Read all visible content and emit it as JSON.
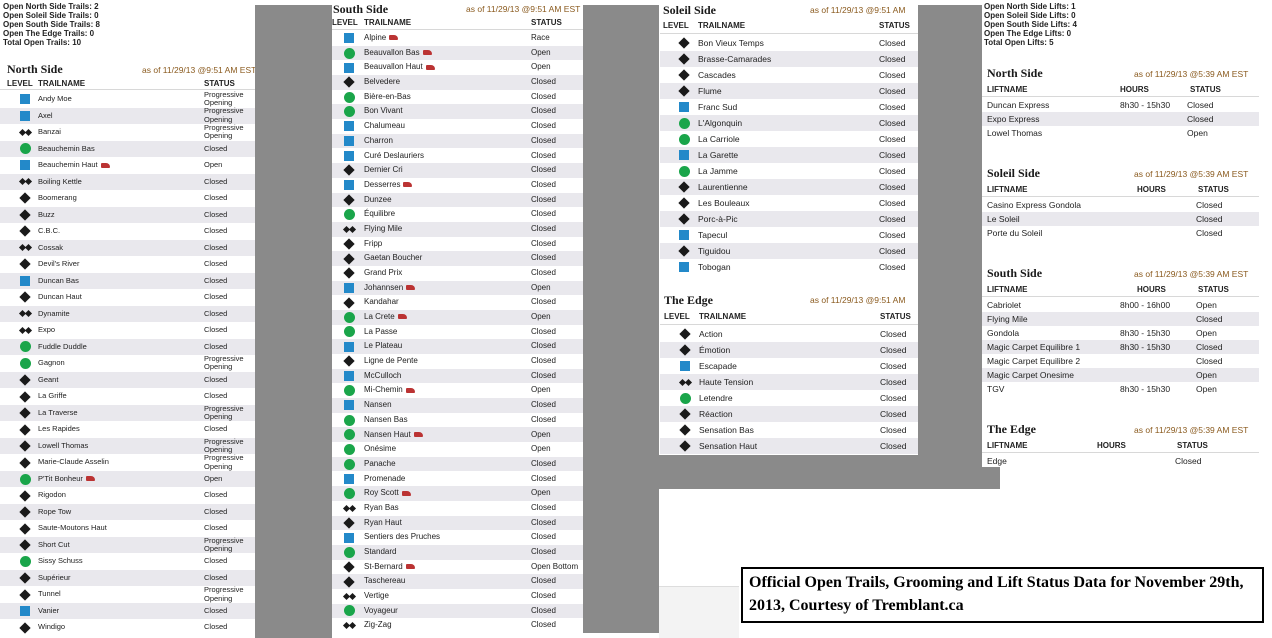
{
  "summary_trails": [
    "Open North Side Trails: 2",
    "Open Soleil Side Trails: 0",
    "Open South Side Trails: 8",
    "Open The Edge Trails: 0",
    "Total Open Trails: 10"
  ],
  "summary_lifts": [
    "Open North Side Lifts: 1",
    "Open Soleil Side Lifts: 0",
    "Open South Side Lifts: 4",
    "Open The Edge Lifts: 0",
    "Total Open Lifts: 5"
  ],
  "headers": {
    "level": "LEVEL",
    "trailname": "TRAILNAME",
    "status": "STATUS",
    "liftname": "LIFTNAME",
    "hours": "HOURS"
  },
  "legend_icons": {
    "sq": "blue-square-icon",
    "ci": "green-circle-icon",
    "dm": "black-diamond-icon",
    "dd": "double-black-diamond-icon"
  },
  "colors": {
    "blue": "#2389c9",
    "green": "#1aa54a",
    "black": "#1a1a1a",
    "asof": "#8a5a1e"
  },
  "north": {
    "title": "North Side",
    "asof": "as of 11/29/13 @9:51 AM EST",
    "trails": [
      {
        "level": "sq",
        "name": "Andy Moe",
        "status": "Progressive Opening"
      },
      {
        "level": "sq",
        "name": "Axel",
        "status": "Progressive Opening"
      },
      {
        "level": "dd",
        "name": "Banzai",
        "status": "Progressive Opening"
      },
      {
        "level": "ci",
        "name": "Beauchemin Bas",
        "status": "Closed"
      },
      {
        "level": "sq",
        "name": "Beauchemin Haut",
        "status": "Open",
        "groomed": true
      },
      {
        "level": "dd",
        "name": "Boiling Kettle",
        "status": "Closed"
      },
      {
        "level": "dm",
        "name": "Boomerang",
        "status": "Closed"
      },
      {
        "level": "dm",
        "name": "Buzz",
        "status": "Closed"
      },
      {
        "level": "dm",
        "name": "C.B.C.",
        "status": "Closed"
      },
      {
        "level": "dd",
        "name": "Cossak",
        "status": "Closed"
      },
      {
        "level": "dm",
        "name": "Devil's River",
        "status": "Closed"
      },
      {
        "level": "sq",
        "name": "Duncan Bas",
        "status": "Closed"
      },
      {
        "level": "dm",
        "name": "Duncan Haut",
        "status": "Closed"
      },
      {
        "level": "dd",
        "name": "Dynamite",
        "status": "Closed"
      },
      {
        "level": "dd",
        "name": "Expo",
        "status": "Closed"
      },
      {
        "level": "ci",
        "name": "Fuddle Duddle",
        "status": "Closed"
      },
      {
        "level": "ci",
        "name": "Gagnon",
        "status": "Progressive Opening"
      },
      {
        "level": "dm",
        "name": "Geant",
        "status": "Closed"
      },
      {
        "level": "dm",
        "name": "La Griffe",
        "status": "Closed"
      },
      {
        "level": "dm",
        "name": "La Traverse",
        "status": "Progressive Opening"
      },
      {
        "level": "dm",
        "name": "Les Rapides",
        "status": "Closed"
      },
      {
        "level": "dm",
        "name": "Lowell Thomas",
        "status": "Progressive Opening"
      },
      {
        "level": "dm",
        "name": "Marie-Claude Asselin",
        "status": "Progressive Opening"
      },
      {
        "level": "ci",
        "name": "P'Tit Bonheur",
        "status": "Open",
        "groomed": true
      },
      {
        "level": "dm",
        "name": "Rigodon",
        "status": "Closed"
      },
      {
        "level": "dm",
        "name": "Rope Tow",
        "status": "Closed"
      },
      {
        "level": "dm",
        "name": "Saute-Moutons Haut",
        "status": "Closed"
      },
      {
        "level": "dm",
        "name": "Short Cut",
        "status": "Progressive Opening"
      },
      {
        "level": "ci",
        "name": "Sissy Schuss",
        "status": "Closed"
      },
      {
        "level": "dm",
        "name": "Supérieur",
        "status": "Closed"
      },
      {
        "level": "dm",
        "name": "Tunnel",
        "status": "Progressive Opening"
      },
      {
        "level": "sq",
        "name": "Vanier",
        "status": "Closed"
      },
      {
        "level": "dm",
        "name": "Windigo",
        "status": "Closed"
      }
    ]
  },
  "south": {
    "title": "South Side",
    "asof": "as of 11/29/13 @9:51 AM EST",
    "trails": [
      {
        "level": "sq",
        "name": "Alpine",
        "status": "Race",
        "groomed": true
      },
      {
        "level": "ci",
        "name": "Beauvallon Bas",
        "status": "Open",
        "groomed": true
      },
      {
        "level": "sq",
        "name": "Beauvallon Haut",
        "status": "Open",
        "groomed": true
      },
      {
        "level": "dm",
        "name": "Belvedere",
        "status": "Closed"
      },
      {
        "level": "ci",
        "name": "Bière-en-Bas",
        "status": "Closed"
      },
      {
        "level": "ci",
        "name": "Bon Vivant",
        "status": "Closed"
      },
      {
        "level": "sq",
        "name": "Chalumeau",
        "status": "Closed"
      },
      {
        "level": "sq",
        "name": "Charron",
        "status": "Closed"
      },
      {
        "level": "sq",
        "name": "Curé Deslauriers",
        "status": "Closed"
      },
      {
        "level": "dm",
        "name": "Dernier Cri",
        "status": "Closed"
      },
      {
        "level": "sq",
        "name": "Desserres",
        "status": "Closed",
        "groomed": true
      },
      {
        "level": "dm",
        "name": "Dunzee",
        "status": "Closed"
      },
      {
        "level": "ci",
        "name": "Équilibre",
        "status": "Closed"
      },
      {
        "level": "dd",
        "name": "Flying Mile",
        "status": "Closed"
      },
      {
        "level": "dm",
        "name": "Fripp",
        "status": "Closed"
      },
      {
        "level": "dm",
        "name": "Gaetan Boucher",
        "status": "Closed"
      },
      {
        "level": "dm",
        "name": "Grand Prix",
        "status": "Closed"
      },
      {
        "level": "sq",
        "name": "Johannsen",
        "status": "Open",
        "groomed": true
      },
      {
        "level": "dm",
        "name": "Kandahar",
        "status": "Closed"
      },
      {
        "level": "ci",
        "name": "La Crete",
        "status": "Open",
        "groomed": true
      },
      {
        "level": "ci",
        "name": "La Passe",
        "status": "Closed"
      },
      {
        "level": "sq",
        "name": "Le Plateau",
        "status": "Closed"
      },
      {
        "level": "dm",
        "name": "Ligne de Pente",
        "status": "Closed"
      },
      {
        "level": "sq",
        "name": "McCulloch",
        "status": "Closed"
      },
      {
        "level": "ci",
        "name": "Mi-Chemin",
        "status": "Open",
        "groomed": true
      },
      {
        "level": "sq",
        "name": "Nansen",
        "status": "Closed"
      },
      {
        "level": "ci",
        "name": "Nansen Bas",
        "status": "Closed"
      },
      {
        "level": "ci",
        "name": "Nansen Haut",
        "status": "Open",
        "groomed": true
      },
      {
        "level": "ci",
        "name": "Onésime",
        "status": "Open"
      },
      {
        "level": "ci",
        "name": "Panache",
        "status": "Closed"
      },
      {
        "level": "sq",
        "name": "Promenade",
        "status": "Closed"
      },
      {
        "level": "ci",
        "name": "Roy Scott",
        "status": "Open",
        "groomed": true
      },
      {
        "level": "dd",
        "name": "Ryan Bas",
        "status": "Closed"
      },
      {
        "level": "dm",
        "name": "Ryan Haut",
        "status": "Closed"
      },
      {
        "level": "sq",
        "name": "Sentiers des Pruches",
        "status": "Closed"
      },
      {
        "level": "ci",
        "name": "Standard",
        "status": "Closed"
      },
      {
        "level": "dm",
        "name": "St-Bernard",
        "status": "Open Bottom",
        "groomed": true
      },
      {
        "level": "dm",
        "name": "Taschereau",
        "status": "Closed"
      },
      {
        "level": "dd",
        "name": "Vertige",
        "status": "Closed"
      },
      {
        "level": "ci",
        "name": "Voyageur",
        "status": "Closed"
      },
      {
        "level": "dd",
        "name": "Zig-Zag",
        "status": "Closed"
      }
    ]
  },
  "soleil": {
    "title": "Soleil Side",
    "asof": "as of 11/29/13 @9:51 AM",
    "trails": [
      {
        "level": "dm",
        "name": "Bon Vieux Temps",
        "status": "Closed"
      },
      {
        "level": "dm",
        "name": "Brasse-Camarades",
        "status": "Closed"
      },
      {
        "level": "dm",
        "name": "Cascades",
        "status": "Closed"
      },
      {
        "level": "dm",
        "name": "Flume",
        "status": "Closed"
      },
      {
        "level": "sq",
        "name": "Franc Sud",
        "status": "Closed"
      },
      {
        "level": "ci",
        "name": "L'Algonquin",
        "status": "Closed"
      },
      {
        "level": "ci",
        "name": "La Carriole",
        "status": "Closed"
      },
      {
        "level": "sq",
        "name": "La Garette",
        "status": "Closed"
      },
      {
        "level": "ci",
        "name": "La Jamme",
        "status": "Closed"
      },
      {
        "level": "dm",
        "name": "Laurentienne",
        "status": "Closed"
      },
      {
        "level": "dm",
        "name": "Les Bouleaux",
        "status": "Closed"
      },
      {
        "level": "dm",
        "name": "Porc-à-Pic",
        "status": "Closed"
      },
      {
        "level": "sq",
        "name": "Tapecul",
        "status": "Closed"
      },
      {
        "level": "dm",
        "name": "Tiguidou",
        "status": "Closed"
      },
      {
        "level": "sq",
        "name": "Tobogan",
        "status": "Closed"
      }
    ]
  },
  "edge": {
    "title": "The Edge",
    "asof": "as of 11/29/13 @9:51 AM",
    "trails": [
      {
        "level": "dm",
        "name": "Action",
        "status": "Closed"
      },
      {
        "level": "dm",
        "name": "Émotion",
        "status": "Closed"
      },
      {
        "level": "sq",
        "name": "Escapade",
        "status": "Closed"
      },
      {
        "level": "dd",
        "name": "Haute Tension",
        "status": "Closed"
      },
      {
        "level": "ci",
        "name": "Letendre",
        "status": "Closed"
      },
      {
        "level": "dm",
        "name": "Réaction",
        "status": "Closed"
      },
      {
        "level": "dm",
        "name": "Sensation Bas",
        "status": "Closed"
      },
      {
        "level": "dm",
        "name": "Sensation Haut",
        "status": "Closed"
      }
    ]
  },
  "lifts": {
    "north": {
      "title": "North Side",
      "asof": "as of 11/29/13 @5:39 AM EST",
      "rows": [
        {
          "name": "Duncan Express",
          "hours": "8h30 - 15h30",
          "status": "Closed"
        },
        {
          "name": "Expo Express",
          "hours": "",
          "status": "Closed"
        },
        {
          "name": "Lowel Thomas",
          "hours": "",
          "status": "Open"
        }
      ]
    },
    "soleil": {
      "title": "Soleil Side",
      "asof": "as of 11/29/13 @5:39 AM EST",
      "rows": [
        {
          "name": "Casino Express Gondola",
          "hours": "",
          "status": "Closed"
        },
        {
          "name": "Le Soleil",
          "hours": "",
          "status": "Closed"
        },
        {
          "name": "Porte du Soleil",
          "hours": "",
          "status": "Closed"
        }
      ]
    },
    "south": {
      "title": "South Side",
      "asof": "as of 11/29/13 @5:39 AM EST",
      "rows": [
        {
          "name": "Cabriolet",
          "hours": "8h00 - 16h00",
          "status": "Open"
        },
        {
          "name": "Flying Mile",
          "hours": "",
          "status": "Closed"
        },
        {
          "name": "Gondola",
          "hours": "8h30 - 15h30",
          "status": "Open"
        },
        {
          "name": "Magic Carpet Equilibre 1",
          "hours": "8h30 - 15h30",
          "status": "Closed"
        },
        {
          "name": "Magic Carpet Equilibre 2",
          "hours": "",
          "status": "Closed"
        },
        {
          "name": "Magic Carpet Onesime",
          "hours": "",
          "status": "Open"
        },
        {
          "name": "TGV",
          "hours": "8h30 - 15h30",
          "status": "Open"
        }
      ]
    },
    "edge": {
      "title": "The Edge",
      "asof": "as of 11/29/13 @5:39 AM EST",
      "rows": [
        {
          "name": "Edge",
          "hours": "",
          "status": "Closed"
        }
      ]
    }
  },
  "caption": "Official Open Trails, Grooming and Lift Status Data for November 29th, 2013, Courtesy of Tremblant.ca"
}
